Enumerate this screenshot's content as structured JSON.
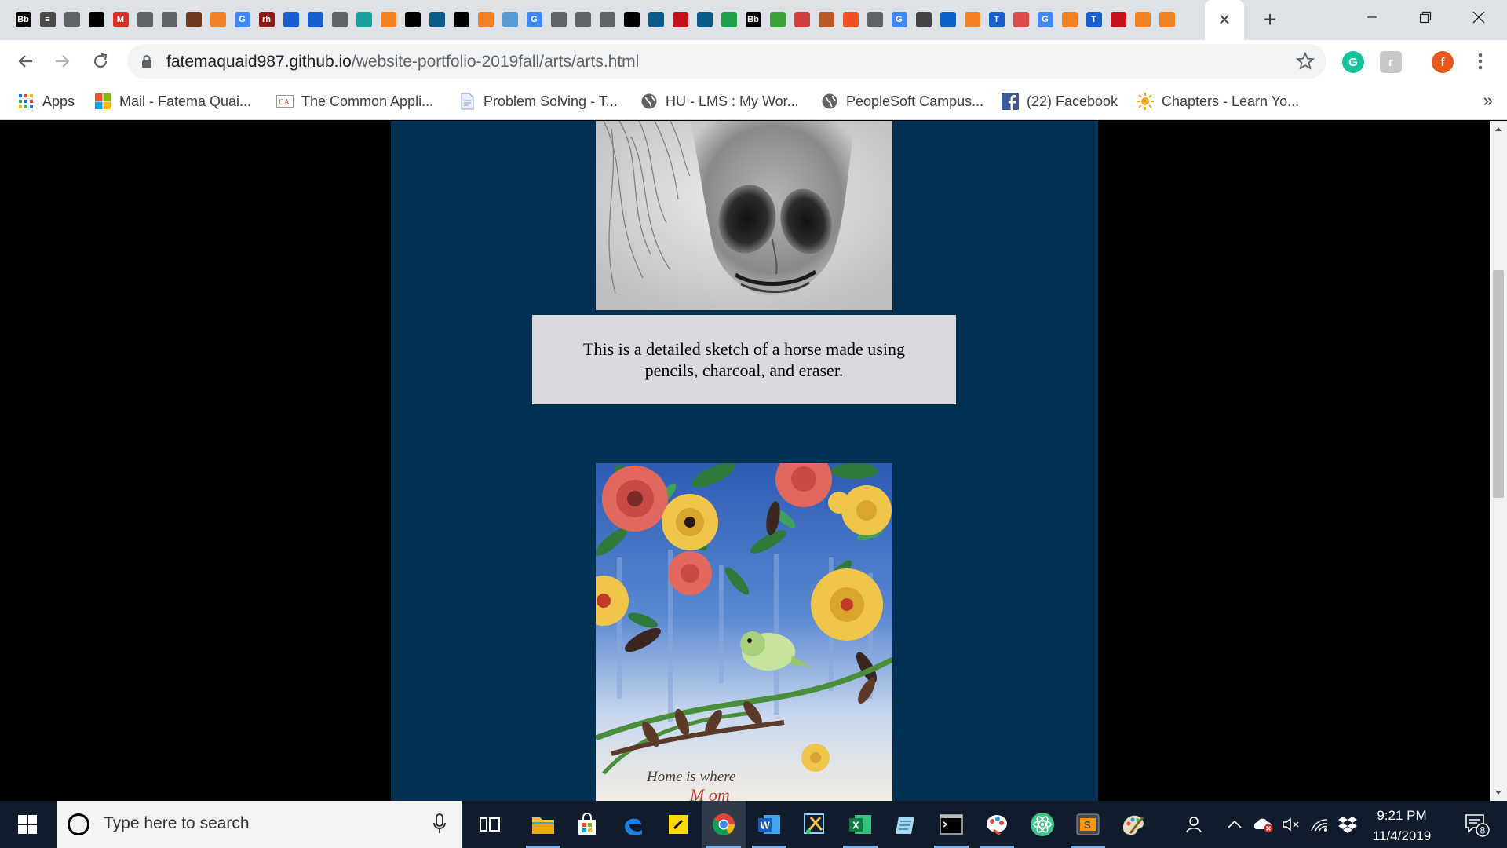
{
  "tabs": {
    "favicons": [
      {
        "icon": "blackboard-icon",
        "text": "Bb",
        "color": "#000000"
      },
      {
        "icon": "docs-icon",
        "text": "≡",
        "color": "#4a4a4a"
      },
      {
        "icon": "globe-icon",
        "text": "",
        "color": "#5f6368"
      },
      {
        "icon": "github-icon",
        "text": "",
        "color": "#000000"
      },
      {
        "icon": "gmail-icon",
        "text": "M",
        "color": "#d93025"
      },
      {
        "icon": "globe-icon",
        "text": "",
        "color": "#5f6368"
      },
      {
        "icon": "globe-icon",
        "text": "",
        "color": "#5f6368"
      },
      {
        "icon": "book-icon",
        "text": "",
        "color": "#6b3a1f"
      },
      {
        "icon": "stackoverflow-icon",
        "text": "",
        "color": "#f48024"
      },
      {
        "icon": "google-icon",
        "text": "G",
        "color": "#4285f4"
      },
      {
        "icon": "rh-icon",
        "text": "rh",
        "color": "#8b1a1a"
      },
      {
        "icon": "shield-icon",
        "text": "",
        "color": "#1a5fd0"
      },
      {
        "icon": "moon-icon",
        "text": "",
        "color": "#1a5fd0"
      },
      {
        "icon": "globe-icon",
        "text": "",
        "color": "#5f6368"
      },
      {
        "icon": "eye-icon",
        "text": "",
        "color": "#1aa0a0"
      },
      {
        "icon": "stackoverflow-icon",
        "text": "",
        "color": "#f48024"
      },
      {
        "icon": "github-icon",
        "text": "",
        "color": "#000000"
      },
      {
        "icon": "grad-cap-icon",
        "text": "",
        "color": "#0a5a8a"
      },
      {
        "icon": "terminal-icon",
        "text": "",
        "color": "#000000"
      },
      {
        "icon": "stackoverflow-icon",
        "text": "",
        "color": "#f48024"
      },
      {
        "icon": "cross-icon",
        "text": "",
        "color": "#5b9bd5"
      },
      {
        "icon": "google-icon",
        "text": "G",
        "color": "#4285f4"
      },
      {
        "icon": "globe-icon",
        "text": "",
        "color": "#5f6368"
      },
      {
        "icon": "globe-icon",
        "text": "",
        "color": "#5f6368"
      },
      {
        "icon": "globe-icon",
        "text": "",
        "color": "#5f6368"
      },
      {
        "icon": "github-icon",
        "text": "",
        "color": "#000000"
      },
      {
        "icon": "grad-cap-icon",
        "text": "",
        "color": "#0a5a8a"
      },
      {
        "icon": "power-icon",
        "text": "",
        "color": "#c4121a"
      },
      {
        "icon": "grad-cap-icon",
        "text": "",
        "color": "#0a5a8a"
      },
      {
        "icon": "chart-icon",
        "text": "",
        "color": "#1fa04a"
      },
      {
        "icon": "blackboard-icon",
        "text": "Bb",
        "color": "#000000"
      },
      {
        "icon": "code-icon",
        "text": "",
        "color": "#3ca03c"
      },
      {
        "icon": "slides-icon",
        "text": "",
        "color": "#d04040"
      },
      {
        "icon": "bookmark-icon",
        "text": "",
        "color": "#b85a2a"
      },
      {
        "icon": "microsoft-icon",
        "text": "",
        "color": "#f25022"
      },
      {
        "icon": "globe-icon",
        "text": "",
        "color": "#5f6368"
      },
      {
        "icon": "google-icon",
        "text": "G",
        "color": "#4285f4"
      },
      {
        "icon": "medium-icon",
        "text": "",
        "color": "#444444"
      },
      {
        "icon": "outlook-icon",
        "text": "",
        "color": "#0a64c8"
      },
      {
        "icon": "stackoverflow-icon",
        "text": "",
        "color": "#f48024"
      },
      {
        "icon": "t-icon",
        "text": "T",
        "color": "#1a5fd0"
      },
      {
        "icon": "swirl-icon",
        "text": "",
        "color": "#e04a4a"
      },
      {
        "icon": "google-icon",
        "text": "G",
        "color": "#4285f4"
      },
      {
        "icon": "stackoverflow-icon",
        "text": "",
        "color": "#f48024"
      },
      {
        "icon": "t-icon",
        "text": "T",
        "color": "#1a5fd0"
      },
      {
        "icon": "square-icon",
        "text": "",
        "color": "#c4121a"
      },
      {
        "icon": "stackoverflow-icon",
        "text": "",
        "color": "#f48024"
      },
      {
        "icon": "spark-icon",
        "text": "",
        "color": "#f08020"
      }
    ],
    "close_glyph": "✕",
    "new_tab_glyph": "+"
  },
  "toolbar": {
    "url_host": "fatemaquaid987.github.io",
    "url_path": "/website-portfolio-2019fall/arts/arts.html",
    "profile_initial": "f",
    "profile_color": "#e8581c"
  },
  "bookmarks": [
    {
      "label": "Apps",
      "icon": "apps-grid-icon"
    },
    {
      "label": "Mail - Fatema Quai...",
      "icon": "microsoft-icon"
    },
    {
      "label": "The Common Appli...",
      "icon": "common-app-icon"
    },
    {
      "label": "Problem Solving - T...",
      "icon": "document-icon"
    },
    {
      "label": "HU - LMS : My Wor...",
      "icon": "globe-icon"
    },
    {
      "label": "PeopleSoft Campus...",
      "icon": "globe-icon"
    },
    {
      "label": "(22) Facebook",
      "icon": "facebook-icon"
    },
    {
      "label": "Chapters - Learn Yo...",
      "icon": "sun-icon"
    }
  ],
  "page": {
    "caption": "This is a detailed sketch of a horse made using pencils, charcoal, and eraser.",
    "painting_text": "Home is where"
  },
  "taskbar": {
    "search_placeholder": "Type here to search",
    "time": "9:21 PM",
    "date": "11/4/2019",
    "notification_count": "8"
  },
  "colors": {
    "page_column": "#003153",
    "caption_box": "#d8dade",
    "taskbar": "#101c2b"
  }
}
